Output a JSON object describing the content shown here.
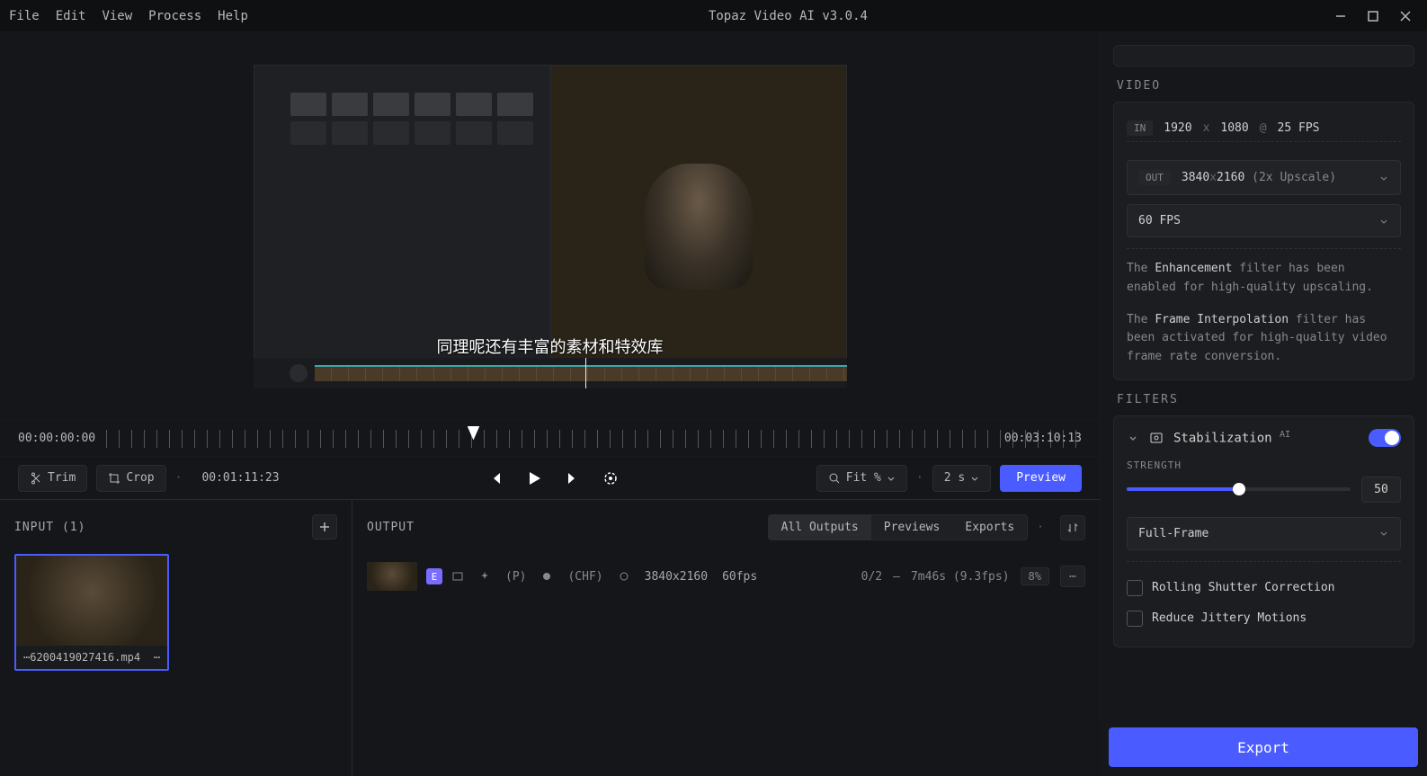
{
  "app": {
    "title": "Topaz Video AI  v3.0.4"
  },
  "menu": {
    "file": "File",
    "edit": "Edit",
    "view": "View",
    "process": "Process",
    "help": "Help"
  },
  "preview": {
    "subtitle": "同理呢还有丰富的素材和特效库"
  },
  "ruler": {
    "start": "00:00:00:00",
    "end": "00:03:10:13",
    "current": "00:01:11:23"
  },
  "tools": {
    "trim": "Trim",
    "crop": "Crop",
    "fit": "Fit %",
    "speed": "2 s",
    "preview": "Preview"
  },
  "input": {
    "title": "INPUT (1)",
    "filename": "⋯6200419027416.mp4"
  },
  "output": {
    "title": "OUTPUT",
    "tabs": {
      "all": "All Outputs",
      "previews": "Previews",
      "exports": "Exports"
    },
    "row": {
      "badge": "E",
      "p": "(P)",
      "chf": "(CHF)",
      "res": "3840x2160",
      "fps": "60fps",
      "progress": "0/2",
      "dash": "—",
      "time": "7m46s (9.3fps)",
      "pct": "8%"
    }
  },
  "sidebar": {
    "video_title": "VIDEO",
    "in": {
      "badge": "IN",
      "w": "1920",
      "x": "x",
      "h": "1080",
      "sep": "@",
      "fps": "25 FPS"
    },
    "out": {
      "badge": "OUT",
      "w": "3840",
      "x": "x",
      "h": "2160",
      "note": "(2x Upscale)"
    },
    "outfps": "60 FPS",
    "info1_pre": "The ",
    "info1_b": "Enhancement",
    "info1_post": " filter has been enabled for high-quality upscaling.",
    "info2_pre": "The ",
    "info2_b": "Frame Interpolation",
    "info2_post": " filter has been activated for high-quality video frame rate conversion.",
    "filters_title": "FILTERS",
    "stab": {
      "name": "Stabilization",
      "ai": "AI"
    },
    "strength": {
      "label": "STRENGTH",
      "value": "50"
    },
    "mode": "Full-Frame",
    "rolling": "Rolling Shutter Correction",
    "jitter": "Reduce Jittery Motions",
    "export": "Export"
  }
}
